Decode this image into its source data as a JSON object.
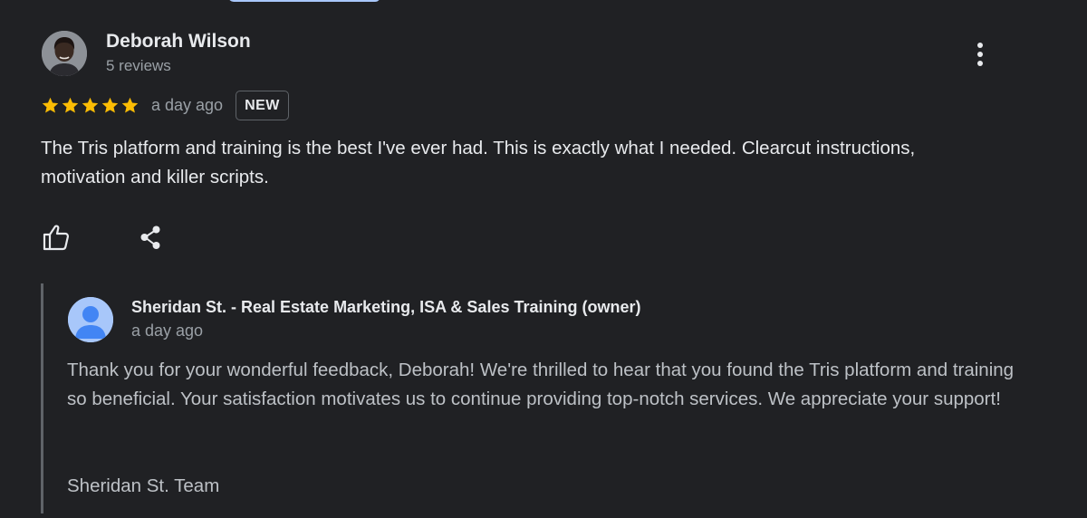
{
  "review": {
    "author_name": "Deborah Wilson",
    "author_meta": "5 reviews",
    "rating": 5,
    "rating_max": 5,
    "date": "a day ago",
    "badge": "NEW",
    "text": "The Tris platform and training is the best I've ever had. This is exactly what I needed. Clearcut instructions, motivation and killer scripts.",
    "icons": {
      "avatar": "user-photo-avatar",
      "more": "more-vert-icon",
      "star": "star-icon",
      "like": "thumbs-up-icon",
      "share": "share-icon"
    }
  },
  "owner_reply": {
    "name": "Sheridan St. - Real Estate Marketing, ISA & Sales Training (owner)",
    "date": "a day ago",
    "text": "Thank you for your wonderful feedback, Deborah! We're thrilled to hear that you found the Tris platform and training so beneficial. Your satisfaction motivates us to continue providing top-notch services. We appreciate your support!",
    "signature": "Sheridan St. Team",
    "icons": {
      "avatar": "default-account-avatar"
    }
  },
  "colors": {
    "background": "#202124",
    "primary_text": "#e8eaed",
    "secondary_text": "#9aa0a6",
    "reply_text": "#bdc1c6",
    "star": "#fbbc04",
    "owner_avatar": "#a8c7fa",
    "owner_avatar_figure": "#4285f4",
    "accent_pill": "#a8c7fa"
  }
}
